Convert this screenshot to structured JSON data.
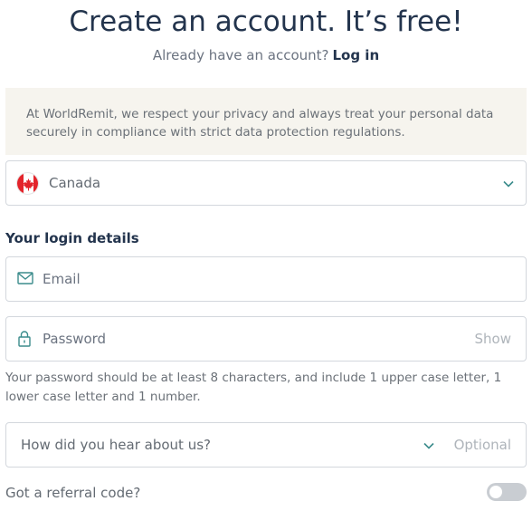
{
  "header": {
    "title": "Create an account. It’s free!",
    "subtitle": "Already have an account?",
    "login_link": "Log in"
  },
  "privacy_notice": "At WorldRemit, we respect your privacy and always treat your personal data securely in compliance with strict data protection regulations.",
  "country": {
    "value": "Canada",
    "flag_icon": "canada-flag-icon"
  },
  "login_details": {
    "heading": "Your login details",
    "email_placeholder": "Email",
    "password_placeholder": "Password",
    "show_label": "Show",
    "password_hint": "Your password should be at least 8 characters, and include 1 upper case letter, 1 lower case letter and 1 number."
  },
  "hear_about": {
    "placeholder": "How did you hear about us?",
    "optional_label": "Optional"
  },
  "referral": {
    "label": "Got a referral code?",
    "enabled": false
  },
  "colors": {
    "title": "#23344d",
    "notice_bg": "#f6f4ee",
    "border": "#d3d7dd",
    "icon_teal": "#3b8c8c",
    "flag_red": "#e3242b"
  }
}
